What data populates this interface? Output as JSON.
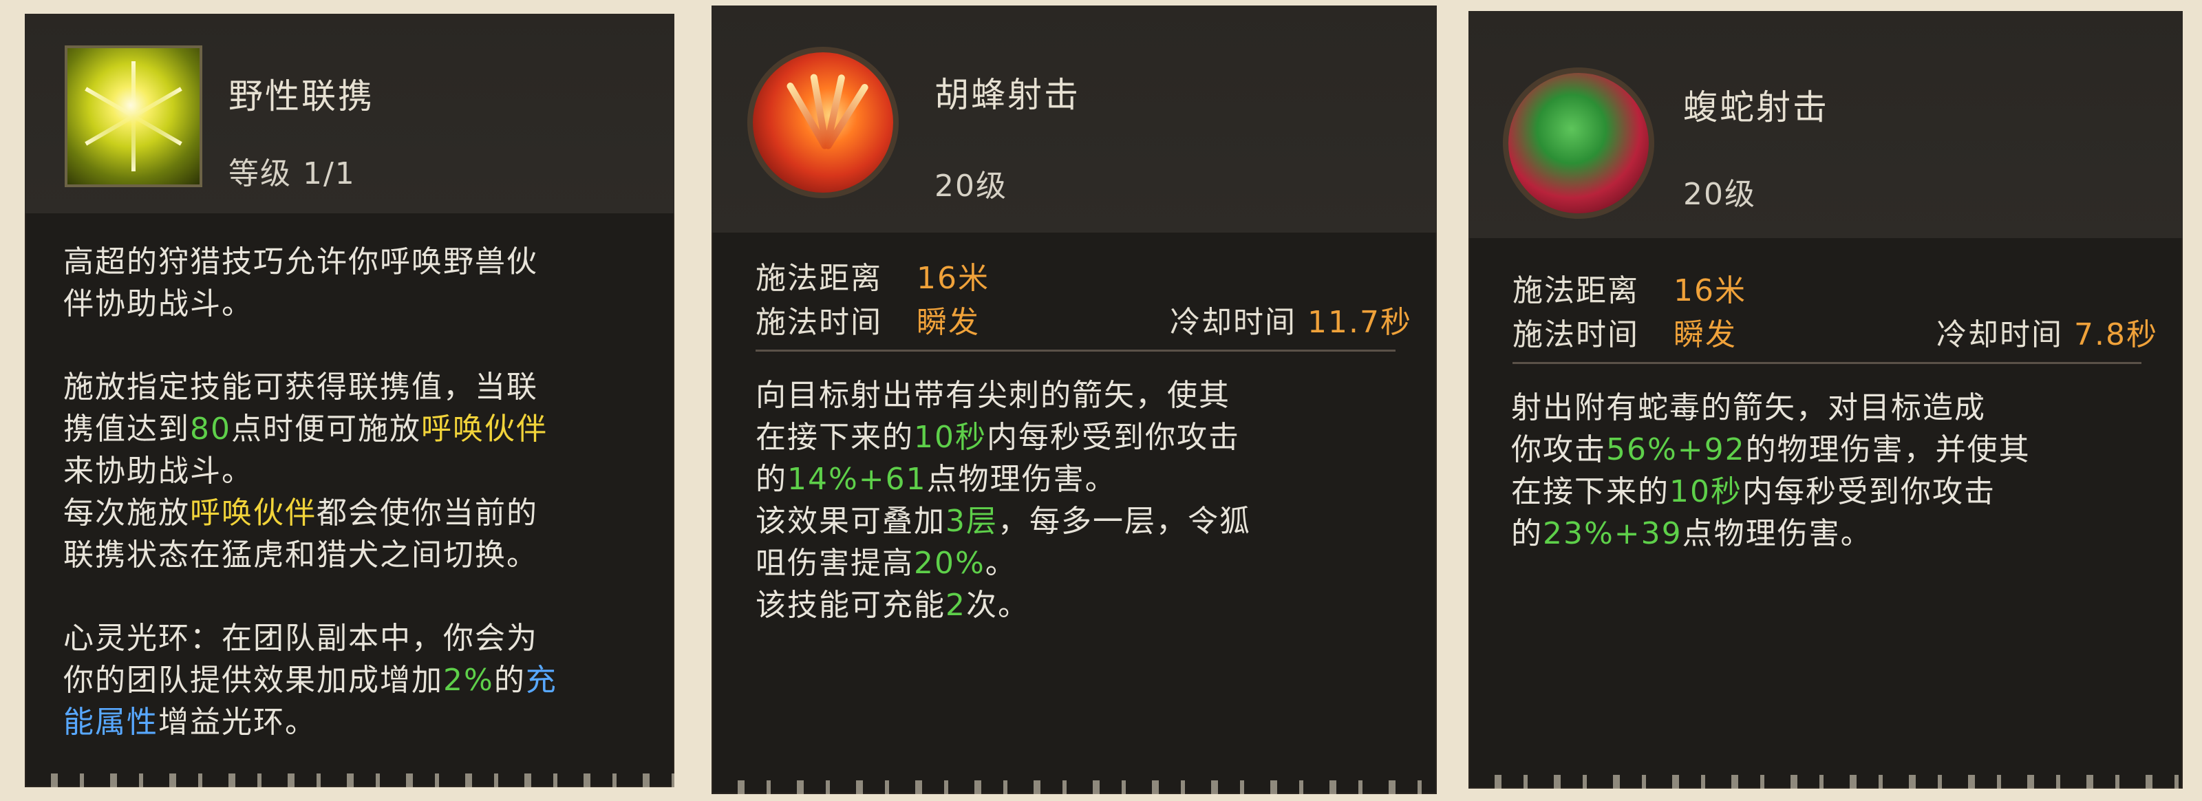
{
  "cards": [
    {
      "name": "野性联携",
      "level": "等级 1/1",
      "icon": "yellow-burst-icon",
      "paragraphs": [
        [
          "高超的狩猎技巧允许你呼唤野兽伙",
          "伴协助战斗。"
        ],
        [
          "施放指定技能可获得联携值，当联",
          "携值达到80点时便可施放呼唤伙伴",
          "来协助战斗。",
          "每次施放呼唤伙伴都会使你当前的",
          "联携状态在猛虎和猎犬之间切换。"
        ],
        [
          "心灵光环：在团队副本中，你会为",
          "你的团队提供效果加成增加2%的充",
          "能属性增益光环。"
        ]
      ]
    },
    {
      "name": "胡蜂射击",
      "level": "20级",
      "icon": "red-claw-icon",
      "cast_range_label": "施法距离",
      "cast_range_value": "16米",
      "cast_time_label": "施法时间",
      "cast_time_value": "瞬发",
      "cooldown_label": "冷却时间",
      "cooldown_value": "11.7秒",
      "lines": [
        "向目标射出带有尖刺的箭矢，使其",
        "在接下来的10秒内每秒受到你攻击",
        "的14%+61点物理伤害。",
        "该效果可叠加3层，每多一层，令狐",
        "咀伤害提高20%。",
        "该技能可充能2次。"
      ]
    },
    {
      "name": "蝮蛇射击",
      "level": "20级",
      "icon": "green-serpent-icon",
      "cast_range_label": "施法距离",
      "cast_range_value": "16米",
      "cast_time_label": "施法时间",
      "cast_time_value": "瞬发",
      "cooldown_label": "冷却时间",
      "cooldown_value": "7.8秒",
      "lines": [
        "射出附有蛇毒的箭矢，对目标造成",
        "你攻击56%+92的物理伤害，并使其",
        "在接下来的10秒内每秒受到你攻击",
        "的23%+39点物理伤害。"
      ]
    }
  ],
  "colors": {
    "card_bg": "#1e1c19",
    "header_bg": "#2e2b27",
    "highlight_green": "#5ed04a",
    "highlight_yellow": "#f2d43a",
    "highlight_blue": "#58a8ff",
    "stat_orange": "#f0a23a"
  }
}
